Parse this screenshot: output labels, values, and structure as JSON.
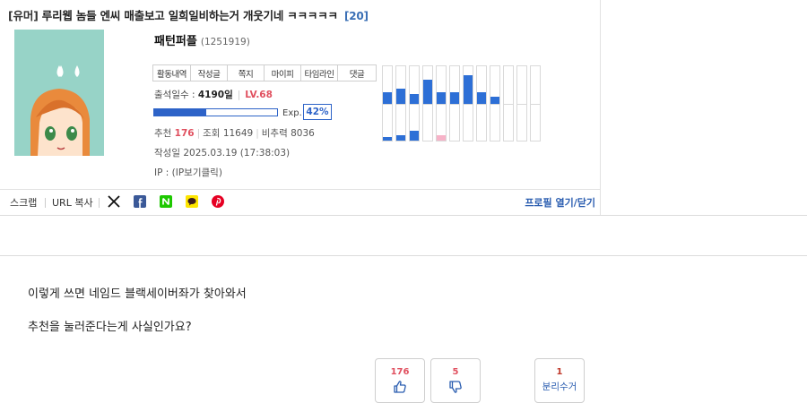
{
  "post": {
    "tag": "[유머]",
    "title": "루리웹 놈들 엔씨 매출보고 일희일비하는거 개웃기네 ㅋㅋㅋㅋㅋ",
    "comment_count": "[20]"
  },
  "author": {
    "nickname": "패턴퍼플",
    "user_id": "(1251919)",
    "buttons": [
      "활동내역",
      "작성글",
      "쪽지",
      "마이피",
      "타임라인",
      "댓글"
    ],
    "attendance_label": "출석일수 :",
    "attendance_value": "4190일",
    "level": "LV.68",
    "exp_label": "Exp.",
    "exp_percent": "42%",
    "exp_fraction": 0.42,
    "recommend_label": "추천",
    "recommend_value": "176",
    "views_label": "조회",
    "views_value": "11649",
    "nonrec_label": "비추력",
    "nonrec_value": "8036",
    "date_label": "작성일",
    "date_value": "2025.03.19 (17:38:03)",
    "ip_label": "IP :",
    "ip_value": "(IP보기클릭)"
  },
  "activity_graph": {
    "up_levels": [
      0.3,
      0.4,
      0.25,
      0.65,
      0.3,
      0.3,
      0.75,
      0.3,
      0.2,
      0,
      0,
      0
    ],
    "down_levels": [
      0.1,
      0.15,
      0.25,
      0,
      0.15,
      0,
      0,
      0,
      0,
      0,
      0,
      0
    ],
    "down_colors": [
      "#2d6fd6",
      "#2d6fd6",
      "#2d6fd6",
      "#ffffff",
      "#f7b3c8",
      "#ffffff",
      "#ffffff",
      "#ffffff",
      "#ffffff",
      "#ffffff",
      "#ffffff",
      "#ffffff"
    ]
  },
  "share": {
    "scrap": "스크랩",
    "copy_url": "URL 복사",
    "icons": [
      "x-icon",
      "facebook-icon",
      "naver-icon",
      "kakao-icon",
      "pinterest-icon"
    ],
    "profile_toggle": "프로필 열기/닫기"
  },
  "content": {
    "lines": [
      "이렇게 쓰면 네임드 블랙세이버좌가 찾아와서",
      "추천을 눌러준다는게 사실인가요?"
    ]
  },
  "votes": {
    "up_count": "176",
    "down_count": "5",
    "report_count": "1",
    "report_label": "분리수거"
  },
  "colors": {
    "accent_blue": "#2d63c8",
    "accent_red": "#e0505f",
    "link_blue": "#2a5db0"
  }
}
